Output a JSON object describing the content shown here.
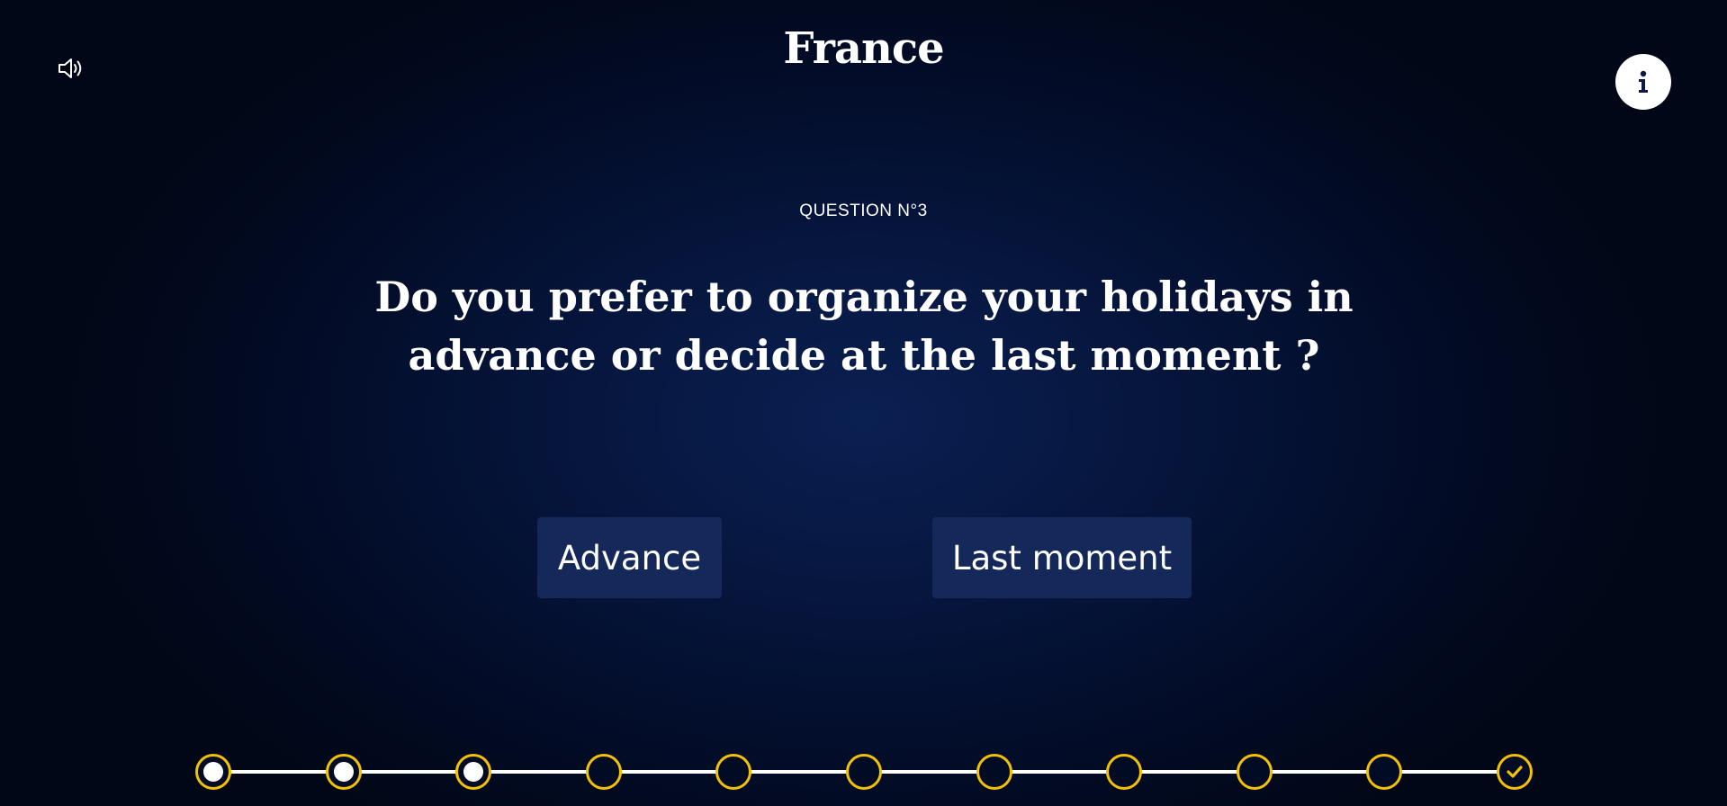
{
  "header": {
    "title": "France",
    "sound_icon": "speaker-volume-icon",
    "info_icon": "info-icon"
  },
  "question": {
    "number_label": "QUESTION N°3",
    "text": "Do you prefer to organize your holidays in advance or decide at the last moment ?"
  },
  "answers": [
    {
      "label": "Advance"
    },
    {
      "label": "Last moment"
    }
  ],
  "progress": {
    "total_steps": 11,
    "completed_steps": 3,
    "final_step_icon": "checkmark-icon"
  },
  "colors": {
    "background": "#020b24",
    "button": "#14295a",
    "accent": "#f2c200",
    "text": "#ffffff"
  }
}
